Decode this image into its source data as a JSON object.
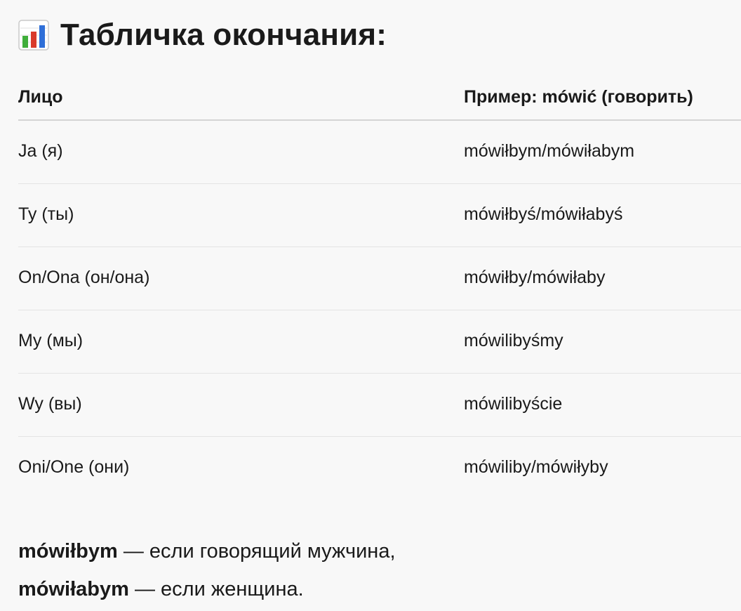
{
  "heading": {
    "icon": "bar-chart-icon",
    "title": "Табличка окончания:"
  },
  "table": {
    "headers": [
      "Лицо",
      "Пример: mówić (говорить)"
    ],
    "rows": [
      [
        "Ja (я)",
        "mówiłbym/mówiłabym"
      ],
      [
        "Ty (ты)",
        "mówiłbyś/mówiłabyś"
      ],
      [
        "On/Ona (он/она)",
        "mówiłby/mówiłaby"
      ],
      [
        "My (мы)",
        "mówilibyśmy"
      ],
      [
        "Wy (вы)",
        "mówilibyście"
      ],
      [
        "Oni/One (они)",
        "mówiliby/mówiłyby"
      ]
    ]
  },
  "notes": [
    {
      "bold": "mówiłbym",
      "rest": " — если говорящий мужчина,"
    },
    {
      "bold": "mówiłabym",
      "rest": " — если женщина."
    }
  ],
  "colors": {
    "background": "#f8f8f8",
    "text": "#1a1a1a",
    "header_rule": "#d4d4d4",
    "row_rule": "#e4e4e4",
    "icon_bar_green": "#3fae3a",
    "icon_bar_red": "#d93a2b",
    "icon_bar_blue": "#2f6fd8"
  }
}
